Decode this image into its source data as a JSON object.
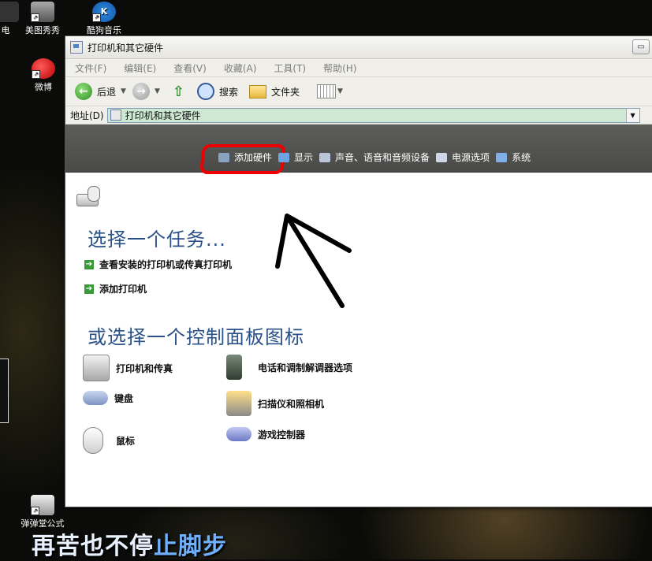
{
  "desktop": {
    "icons": [
      {
        "label": "电"
      },
      {
        "label": "美图秀秀"
      },
      {
        "label": "酷狗音乐"
      },
      {
        "label": "微博"
      },
      {
        "label": "弹弹堂公式"
      }
    ],
    "slogan_a": "再苦也不停",
    "slogan_b": "止脚步"
  },
  "window": {
    "title": "打印机和其它硬件",
    "menu": [
      "文件(F)",
      "编辑(E)",
      "查看(V)",
      "收藏(A)",
      "工具(T)",
      "帮助(H)"
    ],
    "toolbar": {
      "back_label": "后退",
      "search_label": "搜索",
      "folders_label": "文件夹"
    },
    "address": {
      "label": "地址(D)",
      "value": "打印机和其它硬件"
    },
    "see_also": [
      {
        "label": "添加硬件",
        "icon": "add-hardware-icon"
      },
      {
        "label": "显示",
        "icon": "display-icon"
      },
      {
        "label": "声音、语音和音频设备",
        "icon": "sound-icon"
      },
      {
        "label": "电源选项",
        "icon": "power-icon"
      },
      {
        "label": "系统",
        "icon": "system-icon"
      }
    ],
    "pick_task_heading": "选择一个任务...",
    "tasks": [
      {
        "label": "查看安装的打印机或传真打印机"
      },
      {
        "label": "添加打印机"
      }
    ],
    "pick_icon_heading": "或选择一个控制面板图标",
    "control_panel_icons": [
      {
        "label": "打印机和传真",
        "icon": "printer-icon"
      },
      {
        "label": "电话和调制解调器选项",
        "icon": "phone-modem-icon"
      },
      {
        "label": "键盘",
        "icon": "keyboard-icon"
      },
      {
        "label": "扫描仪和照相机",
        "icon": "scanner-camera-icon"
      },
      {
        "label": "鼠标",
        "icon": "mouse-icon"
      },
      {
        "label": "游戏控制器",
        "icon": "game-controller-icon"
      }
    ],
    "colors": {
      "heading": "#2a5288",
      "category_bar": "#555553",
      "highlight": "#ee0000",
      "address_bg": "#cfe8d4"
    }
  }
}
